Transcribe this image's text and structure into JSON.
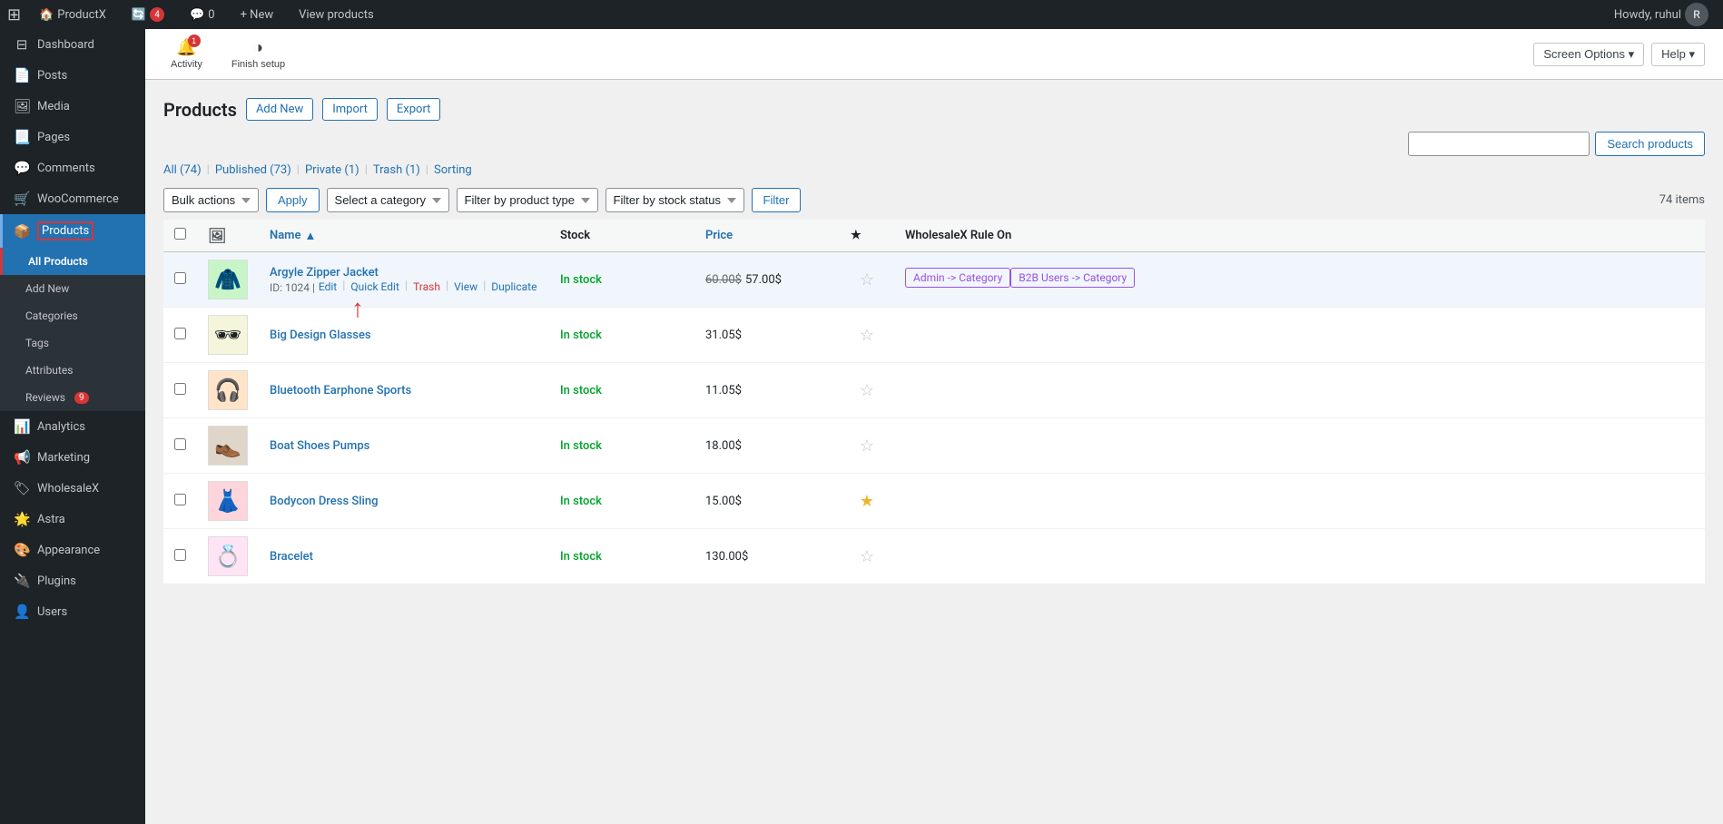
{
  "adminbar": {
    "wp_logo": "⊞",
    "site_name": "ProductX",
    "updates_count": "4",
    "comments_count": "0",
    "new_label": "+ New",
    "view_label": "View products",
    "howdy": "Howdy, ruhul",
    "avatar_initial": "R"
  },
  "header": {
    "activity_label": "Activity",
    "finish_setup_label": "Finish setup",
    "screen_options_label": "Screen Options ▾",
    "help_label": "Help ▾"
  },
  "sidebar": {
    "items": [
      {
        "id": "dashboard",
        "label": "Dashboard",
        "icon": "⊟"
      },
      {
        "id": "posts",
        "label": "Posts",
        "icon": "📄"
      },
      {
        "id": "media",
        "label": "Media",
        "icon": "🖼"
      },
      {
        "id": "pages",
        "label": "Pages",
        "icon": "📃"
      },
      {
        "id": "comments",
        "label": "Comments",
        "icon": "💬"
      },
      {
        "id": "woocommerce",
        "label": "WooCommerce",
        "icon": "🛒"
      },
      {
        "id": "products",
        "label": "Products",
        "icon": "📦",
        "active": true
      },
      {
        "id": "analytics",
        "label": "Analytics",
        "icon": "📊"
      },
      {
        "id": "marketing",
        "label": "Marketing",
        "icon": "📢"
      },
      {
        "id": "wholesalex",
        "label": "WholesaleX",
        "icon": "🏷"
      },
      {
        "id": "astra",
        "label": "Astra",
        "icon": "🌟"
      },
      {
        "id": "appearance",
        "label": "Appearance",
        "icon": "🎨"
      },
      {
        "id": "plugins",
        "label": "Plugins",
        "icon": "🔌"
      },
      {
        "id": "users",
        "label": "Users",
        "icon": "👤"
      }
    ],
    "products_submenu": [
      {
        "id": "all-products",
        "label": "All Products",
        "active": true
      },
      {
        "id": "add-new",
        "label": "Add New"
      },
      {
        "id": "categories",
        "label": "Categories"
      },
      {
        "id": "tags",
        "label": "Tags"
      },
      {
        "id": "attributes",
        "label": "Attributes"
      },
      {
        "id": "reviews",
        "label": "Reviews",
        "badge": "9"
      }
    ]
  },
  "page": {
    "title": "Products",
    "add_new_label": "Add New",
    "import_label": "Import",
    "export_label": "Export"
  },
  "filters": {
    "all_label": "All",
    "all_count": "74",
    "published_label": "Published",
    "published_count": "73",
    "private_label": "Private",
    "private_count": "1",
    "trash_label": "Trash",
    "trash_count": "1",
    "sorting_label": "Sorting"
  },
  "tablenav": {
    "bulk_actions_label": "Bulk actions",
    "apply_label": "Apply",
    "select_category_label": "Select a category",
    "filter_product_type_label": "Filter by product type",
    "filter_stock_label": "Filter by stock status",
    "filter_btn_label": "Filter",
    "items_count": "74 items"
  },
  "search": {
    "placeholder": "",
    "button_label": "Search products"
  },
  "table": {
    "col_name": "Name",
    "col_stock": "Stock",
    "col_price": "Price",
    "col_featured": "★",
    "col_wholesale": "WholesaleX Rule On",
    "sort_indicator": "▲"
  },
  "products": [
    {
      "id": 1,
      "thumb_type": "jacket",
      "thumb_emoji": "🧥",
      "name": "Argyle Zipper Jacket",
      "product_id": "1024",
      "stock": "In stock",
      "stock_class": "in",
      "price_old": "60.00$",
      "price_new": "57.00$",
      "featured": false,
      "wholesale_tags": [
        "Admin -> Category",
        "B2B Users -> Category"
      ],
      "show_actions": true,
      "actions": [
        {
          "label": "Edit",
          "type": "normal"
        },
        {
          "label": "Quick Edit",
          "type": "normal"
        },
        {
          "label": "Trash",
          "type": "delete"
        },
        {
          "label": "View",
          "type": "normal"
        },
        {
          "label": "Duplicate",
          "type": "normal"
        }
      ]
    },
    {
      "id": 2,
      "thumb_type": "glasses",
      "thumb_emoji": "🕶",
      "name": "Big Design Glasses",
      "product_id": "",
      "stock": "In stock",
      "stock_class": "in",
      "price_old": "",
      "price_new": "31.05$",
      "featured": false,
      "wholesale_tags": [],
      "show_actions": false
    },
    {
      "id": 3,
      "thumb_type": "earphone",
      "thumb_emoji": "🎧",
      "name": "Bluetooth Earphone Sports",
      "product_id": "",
      "stock": "In stock",
      "stock_class": "in",
      "price_old": "",
      "price_new": "11.05$",
      "featured": false,
      "wholesale_tags": [],
      "show_actions": false
    },
    {
      "id": 4,
      "thumb_type": "shoes",
      "thumb_emoji": "👞",
      "name": "Boat Shoes Pumps",
      "product_id": "",
      "stock": "In stock",
      "stock_class": "in",
      "price_old": "",
      "price_new": "18.00$",
      "featured": false,
      "wholesale_tags": [],
      "show_actions": false
    },
    {
      "id": 5,
      "thumb_type": "dress",
      "thumb_emoji": "👗",
      "name": "Bodycon Dress Sling",
      "product_id": "",
      "stock": "In stock",
      "stock_class": "in",
      "price_old": "",
      "price_new": "15.00$",
      "featured": true,
      "wholesale_tags": [],
      "show_actions": false
    },
    {
      "id": 6,
      "thumb_type": "bracelet",
      "thumb_emoji": "💍",
      "name": "Bracelet",
      "product_id": "",
      "stock": "In stock",
      "stock_class": "in",
      "price_old": "",
      "price_new": "130.00$",
      "featured": false,
      "wholesale_tags": [],
      "show_actions": false
    }
  ]
}
